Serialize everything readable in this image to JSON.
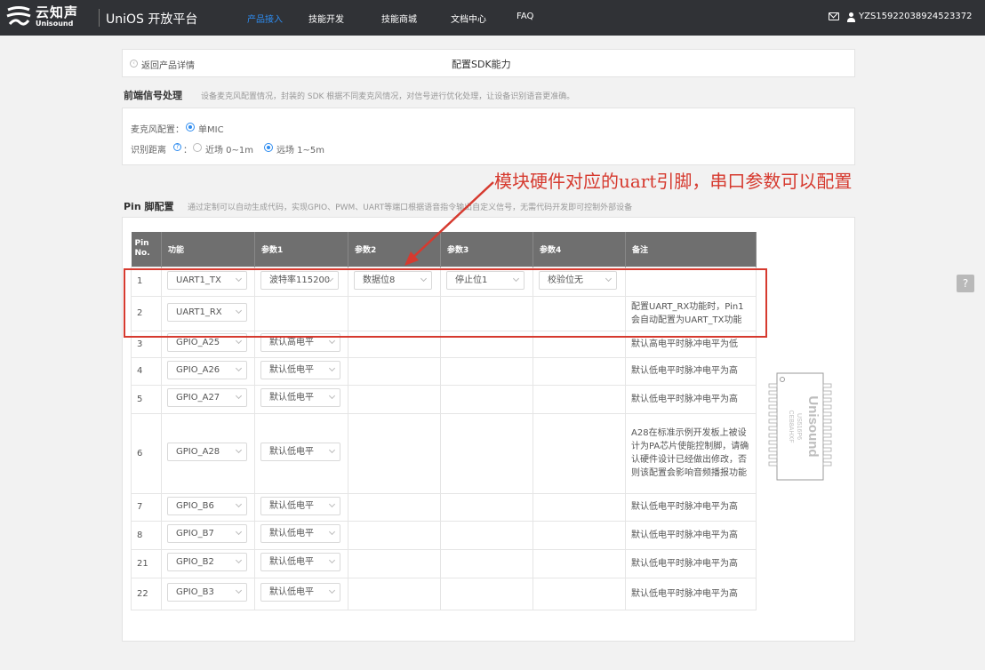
{
  "header": {
    "logo_cn": "云知声",
    "logo_en": "Unisound",
    "app_title": "UniOS 开放平台",
    "nav": [
      "产品接入",
      "技能开发",
      "技能商城",
      "文档中心",
      "FAQ"
    ],
    "active_nav": "产品接入",
    "user_id": "YZS15922038924523372"
  },
  "breadcrumb": {
    "back_label": "返回产品详情",
    "page_title": "配置SDK能力"
  },
  "frontend": {
    "title": "前端信号处理",
    "desc": "设备麦克风配置情况，封装的 SDK 根据不同麦克风情况，对信号进行优化处理，让设备识别语音更准确。",
    "mic_label": "麦克风配置：",
    "mic_option": "单MIC",
    "distance_label": "识别距离",
    "distance_colon": "：",
    "distance_options": [
      "近场 0~1m",
      "远场 1~5m"
    ],
    "distance_selected": "远场 1~5m"
  },
  "annotation": "模块硬件对应的uart引脚，串口参数可以配置",
  "pin": {
    "title": "Pin 脚配置",
    "desc": "通过定制可以自动生成代码，实现GPIO、PWM、UART等端口根据语音指令输出自定义信号，无需代码开发即可控制外部设备",
    "headers": [
      "Pin No.",
      "功能",
      "参数1",
      "参数2",
      "参数3",
      "参数4",
      "备注"
    ],
    "rows": [
      {
        "no": "1",
        "func": "UART1_TX",
        "p1": "波特率115200",
        "p2": "数据位8",
        "p3": "停止位1",
        "p4": "校验位无",
        "note": ""
      },
      {
        "no": "2",
        "func": "UART1_RX",
        "p1": "",
        "p2": "",
        "p3": "",
        "p4": "",
        "note": "配置UART_RX功能时，Pin1会自动配置为UART_TX功能"
      },
      {
        "no": "3",
        "func": "GPIO_A25",
        "p1": "默认高电平",
        "p2": "",
        "p3": "",
        "p4": "",
        "note": "默认高电平时脉冲电平为低"
      },
      {
        "no": "4",
        "func": "GPIO_A26",
        "p1": "默认低电平",
        "p2": "",
        "p3": "",
        "p4": "",
        "note": "默认低电平时脉冲电平为高"
      },
      {
        "no": "5",
        "func": "GPIO_A27",
        "p1": "默认低电平",
        "p2": "",
        "p3": "",
        "p4": "",
        "note": "默认低电平时脉冲电平为高"
      },
      {
        "no": "6",
        "func": "GPIO_A28",
        "p1": "默认低电平",
        "p2": "",
        "p3": "",
        "p4": "",
        "note": "A28在标准示例开发板上被设计为PA芯片使能控制脚，请确认硬件设计已经做出修改，否则该配置会影响音频播报功能"
      },
      {
        "no": "7",
        "func": "GPIO_B6",
        "p1": "默认低电平",
        "p2": "",
        "p3": "",
        "p4": "",
        "note": "默认低电平时脉冲电平为高"
      },
      {
        "no": "8",
        "func": "GPIO_B7",
        "p1": "默认低电平",
        "p2": "",
        "p3": "",
        "p4": "",
        "note": "默认低电平时脉冲电平为高"
      },
      {
        "no": "21",
        "func": "GPIO_B2",
        "p1": "默认低电平",
        "p2": "",
        "p3": "",
        "p4": "",
        "note": "默认低电平时脉冲电平为高"
      },
      {
        "no": "22",
        "func": "GPIO_B3",
        "p1": "默认低电平",
        "p2": "",
        "p3": "",
        "p4": "",
        "note": "默认低电平时脉冲电平为高"
      }
    ]
  },
  "chip": {
    "brand": "Unisound",
    "model": "US516P6",
    "code": "CEB8AHXF"
  },
  "colors": {
    "topbar": "#303236",
    "accent": "#2e8cf0",
    "annotation": "#d63a2f",
    "table_header": "#6f6f6f"
  }
}
